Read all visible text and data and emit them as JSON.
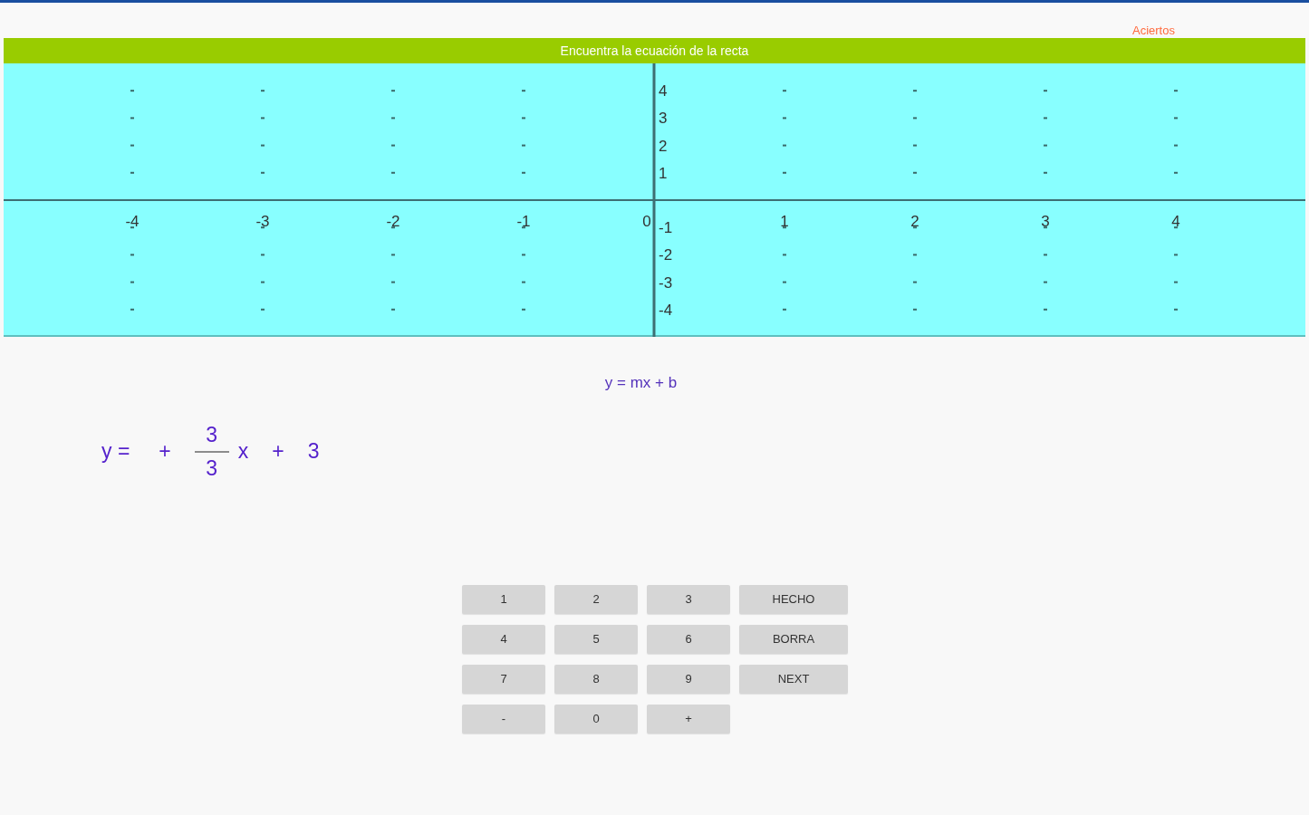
{
  "score_label": "Aciertos",
  "banner": "Encuentra la ecuación de la recta",
  "graph": {
    "x_labels": [
      "-4",
      "-3",
      "-2",
      "-1",
      "0",
      "1",
      "2",
      "3",
      "4"
    ],
    "y_labels": [
      "4",
      "3",
      "2",
      "1",
      "-1",
      "-2",
      "-3",
      "-4"
    ]
  },
  "formula_hint": "y = mx + b",
  "equation": {
    "lhs": "y =",
    "sign": "+",
    "numerator": "3",
    "denominator": "3",
    "variable": "x",
    "operator": "+",
    "constant": "3"
  },
  "keypad": [
    "1",
    "2",
    "3",
    "HECHO",
    "4",
    "5",
    "6",
    "BORRA",
    "7",
    "8",
    "9",
    "NEXT",
    "-",
    "0",
    "+"
  ]
}
